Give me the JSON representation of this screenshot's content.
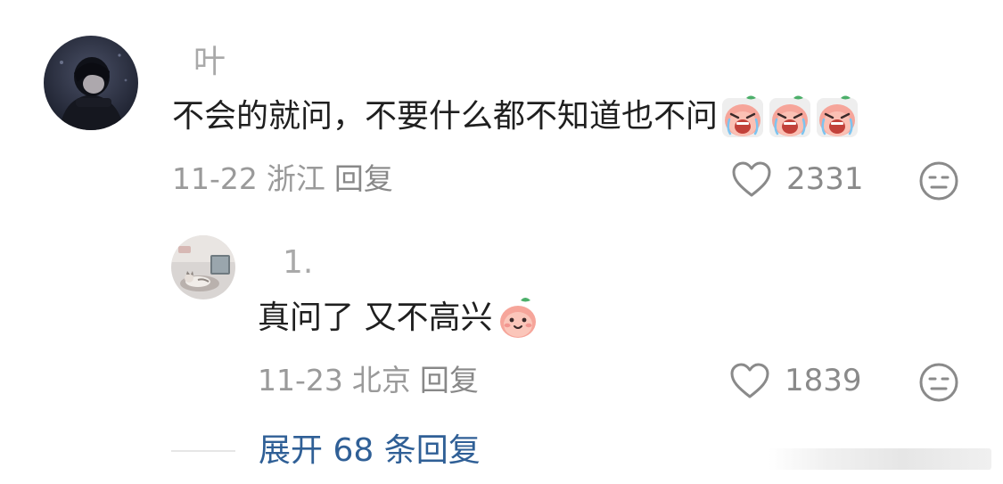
{
  "comment": {
    "avatar_icon": "avatar-dark-anime-icon",
    "username": "叶",
    "text": "不会的就问，不要什么都不知道也不问",
    "emoji_count": 3,
    "emoji_icon": "crying-peach-emoji-icon",
    "date": "11-22",
    "location": "浙江",
    "reply_label": "回复",
    "like_icon": "heart-outline-icon",
    "like_count": "2331",
    "dislike_icon": "meh-face-icon"
  },
  "reply": {
    "avatar_icon": "avatar-cat-photo-icon",
    "username": "1.",
    "text": "真问了 又不高兴",
    "emoji_icon": "smiling-peach-emoji-icon",
    "date": "11-23",
    "location": "北京",
    "reply_label": "回复",
    "like_icon": "heart-outline-icon",
    "like_count": "1839",
    "dislike_icon": "meh-face-icon"
  },
  "expand": {
    "label": "展开 68 条回复"
  },
  "colors": {
    "link_blue": "#2f5f96",
    "meta_gray": "#9a9a9a",
    "text_dark": "#1f1f1f",
    "peach_pink": "#f6a59a"
  }
}
